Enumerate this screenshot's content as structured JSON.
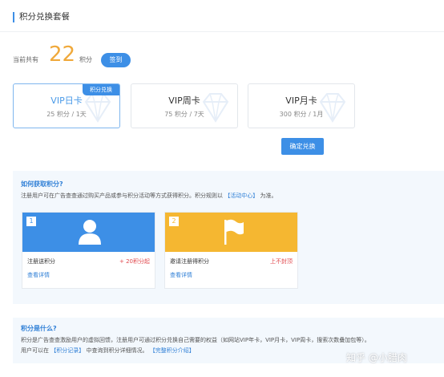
{
  "header": {
    "title": "积分兑换套餐"
  },
  "balance": {
    "label": "当前共有",
    "points": "22",
    "unit": "积分",
    "signin_label": "签到"
  },
  "packages": [
    {
      "title": "VIP日卡",
      "subtitle": "25 积分 / 1天",
      "badge": "积分兑换",
      "selected": true
    },
    {
      "title": "VIP周卡",
      "subtitle": "75 积分 / 7天",
      "selected": false
    },
    {
      "title": "VIP月卡",
      "subtitle": "300 积分 / 1月",
      "selected": false
    }
  ],
  "confirm_label": "确定兑换",
  "how": {
    "title": "如何获取积分?",
    "text_before": "注册用户可在广告查查通过购买产品或参与积分活动等方式获得积分。积分规则以",
    "link": "【活动中心】",
    "text_after": "为准。"
  },
  "tasks": [
    {
      "number": "1",
      "name": "注册送积分",
      "reward": "+ 20积分起",
      "detail": "查看详情",
      "color": "#3d8fe6",
      "icon": "user-icon"
    },
    {
      "number": "2",
      "name": "邀请注册得积分",
      "reward": "上不封顶",
      "detail": "查看详情",
      "color": "#f5b731",
      "icon": "flag-icon"
    }
  ],
  "what": {
    "title": "积分是什么?",
    "line1": "积分是广告查查激励用户的虚拟回馈，注册用户可通过积分兑换自己需要的权益（如网站VIP年卡，VIP月卡，VIP周卡，搜索次数叠加包等）。",
    "line2_before": "用户可以在",
    "link1": "【积分记录】",
    "line2_mid": "中查询到积分详细情况。",
    "link2": "【完整积分介绍】"
  },
  "watermark": "知乎 @小腊肉"
}
